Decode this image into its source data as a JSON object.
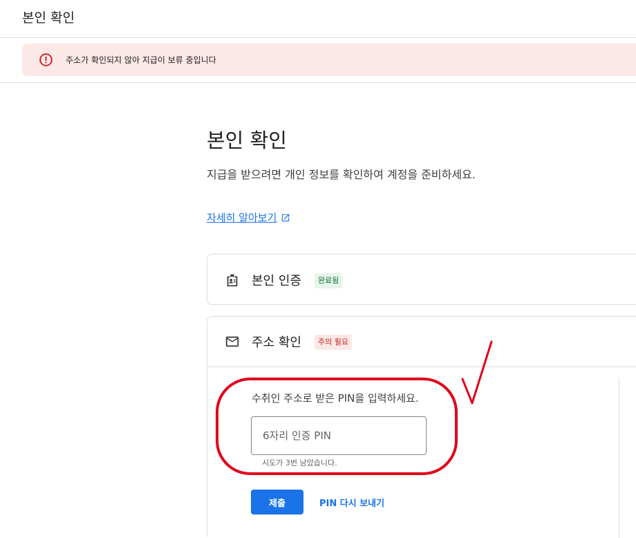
{
  "header": {
    "title": "본인 확인"
  },
  "alert": {
    "text": "주소가 확인되지 않아 지급이 보류 중입니다",
    "icon": "error-icon",
    "background": "#fce8e6",
    "icon_color": "#c5221f"
  },
  "main": {
    "heading": "본인 확인",
    "description": "지급을 받으려면 개인 정보를 확인하여 계정을 준비하세요.",
    "learn_more": "자세히 알아보기"
  },
  "identity_card": {
    "icon": "id-badge-icon",
    "title": "본인 인증",
    "status": "완료됨",
    "status_color": "#137333"
  },
  "address_card": {
    "icon": "mail-icon",
    "title": "주소 확인",
    "status": "주의 필요",
    "status_color": "#c5221f",
    "pin_prompt": "수취인 주소로 받은 PIN을 입력하세요.",
    "pin_placeholder": "6자리 인증 PIN",
    "pin_value": "",
    "attempts_text": "시도가 3번 남았습니다.",
    "submit_label": "제출",
    "resend_label": "PIN 다시 보내기"
  },
  "colors": {
    "accent": "#1a73e8",
    "annotation": "#e0001b"
  }
}
